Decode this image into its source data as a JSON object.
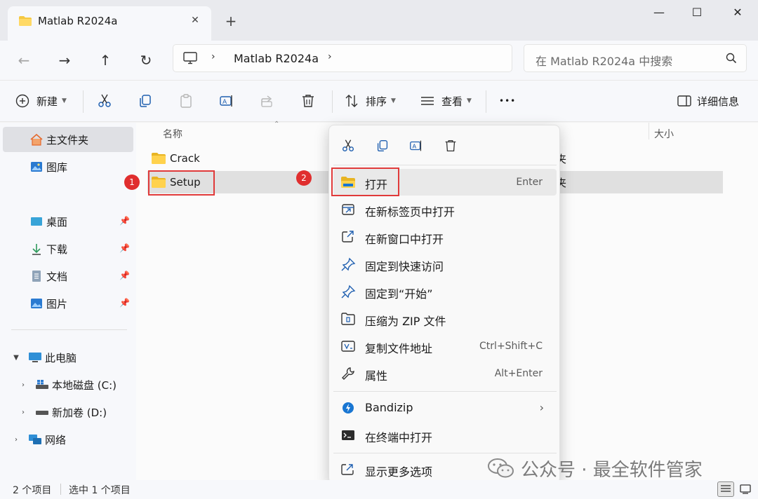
{
  "tab": {
    "title": "Matlab R2024a",
    "close": "✕",
    "new_tab": "+"
  },
  "window": {
    "minimize": "—",
    "maximize": "☐",
    "close": "✕"
  },
  "nav": {
    "back": "←",
    "forward": "→",
    "up": "↑",
    "refresh": "↻"
  },
  "address": {
    "chevron": "›",
    "path": "Matlab R2024a"
  },
  "search": {
    "placeholder": "在 Matlab R2024a 中搜索"
  },
  "toolbar": {
    "new_label": "新建",
    "sort_label": "排序",
    "view_label": "查看",
    "more": "•••",
    "details_label": "详细信息"
  },
  "sidebar": {
    "home": "主文件夹",
    "gallery": "图库",
    "desktop": "桌面",
    "downloads": "下载",
    "documents": "文档",
    "pictures": "图片",
    "this_pc": "此电脑",
    "local_disk": "本地磁盘 (C:)",
    "new_volume": "新加卷 (D:)",
    "network": "网络"
  },
  "main": {
    "columns": {
      "name": "名称",
      "size": "大小"
    },
    "rows": [
      {
        "name": "Crack",
        "type_fragment": "夹"
      },
      {
        "name": "Setup",
        "type_fragment": "夹"
      }
    ],
    "badges": [
      "1",
      "2"
    ]
  },
  "context_menu": {
    "items": [
      {
        "label": "打开",
        "shortcut": "Enter",
        "icon": "open-folder-icon"
      },
      {
        "label": "在新标签页中打开",
        "shortcut": "",
        "icon": "new-tab-icon"
      },
      {
        "label": "在新窗口中打开",
        "shortcut": "",
        "icon": "new-window-icon"
      },
      {
        "label": "固定到快速访问",
        "shortcut": "",
        "icon": "pin-icon"
      },
      {
        "label": "固定到“开始”",
        "shortcut": "",
        "icon": "pin-icon"
      },
      {
        "label": "压缩为 ZIP 文件",
        "shortcut": "",
        "icon": "zip-icon"
      },
      {
        "label": "复制文件地址",
        "shortcut": "Ctrl+Shift+C",
        "icon": "copy-path-icon"
      },
      {
        "label": "属性",
        "shortcut": "Alt+Enter",
        "icon": "wrench-icon"
      },
      {
        "label": "Bandizip",
        "shortcut": "",
        "icon": "bandizip-icon"
      },
      {
        "label": "在终端中打开",
        "shortcut": "",
        "icon": "terminal-icon"
      },
      {
        "label": "显示更多选项",
        "shortcut": "",
        "icon": "more-options-icon"
      }
    ],
    "submenu_arrow": "›"
  },
  "status": {
    "count": "2 个项目",
    "selected": "选中 1 个项目"
  },
  "watermark": {
    "text": "公众号 · 最全软件管家"
  },
  "colors": {
    "highlight": "#e03a3a",
    "folder": "#f5c842",
    "accent": "#1976d2"
  }
}
